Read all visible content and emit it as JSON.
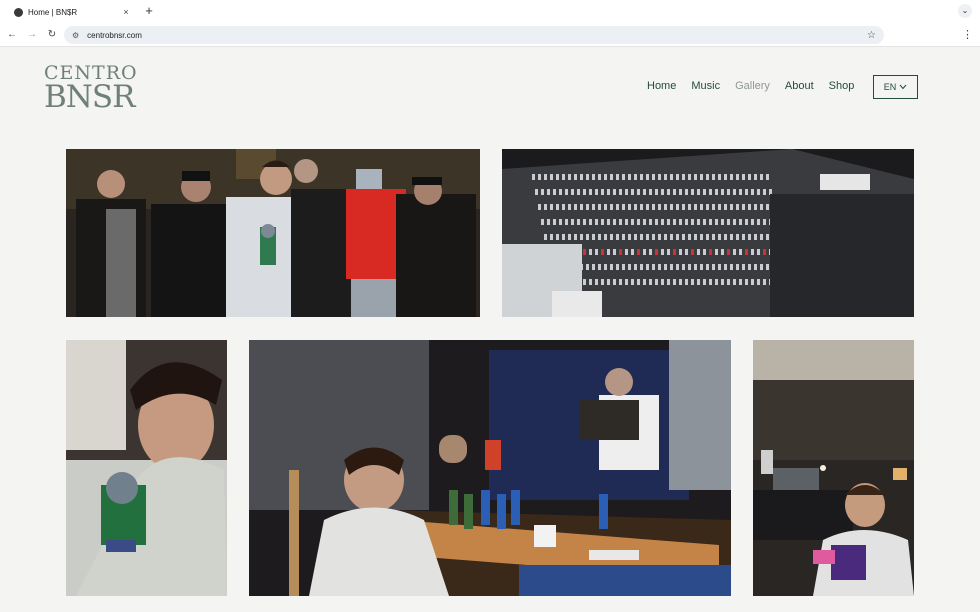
{
  "browser": {
    "tab_title": "Home | BN$R",
    "tab_close": "×",
    "new_tab": "+",
    "url": "centrobnsr.com"
  },
  "site": {
    "logo_line1": "CENTRO",
    "logo_line2": "BNSR",
    "nav": [
      {
        "label": "Home",
        "active": false
      },
      {
        "label": "Music",
        "active": false
      },
      {
        "label": "Gallery",
        "active": true
      },
      {
        "label": "About",
        "active": false
      },
      {
        "label": "Shop",
        "active": false
      }
    ],
    "language": "EN"
  },
  "colors": {
    "accent": "#244b3f",
    "muted": "#8f9893",
    "background": "#f4f4f2"
  },
  "icons": {
    "back": "arrow-left",
    "forward": "arrow-right",
    "reload": "reload",
    "bookmark": "star",
    "menu": "kebab",
    "language_toggle": "chevron-down"
  },
  "gallery": [
    {
      "name": "photo-group"
    },
    {
      "name": "photo-mixing-console"
    },
    {
      "name": "photo-portrait"
    },
    {
      "name": "photo-studio-table"
    },
    {
      "name": "photo-control-room"
    }
  ]
}
